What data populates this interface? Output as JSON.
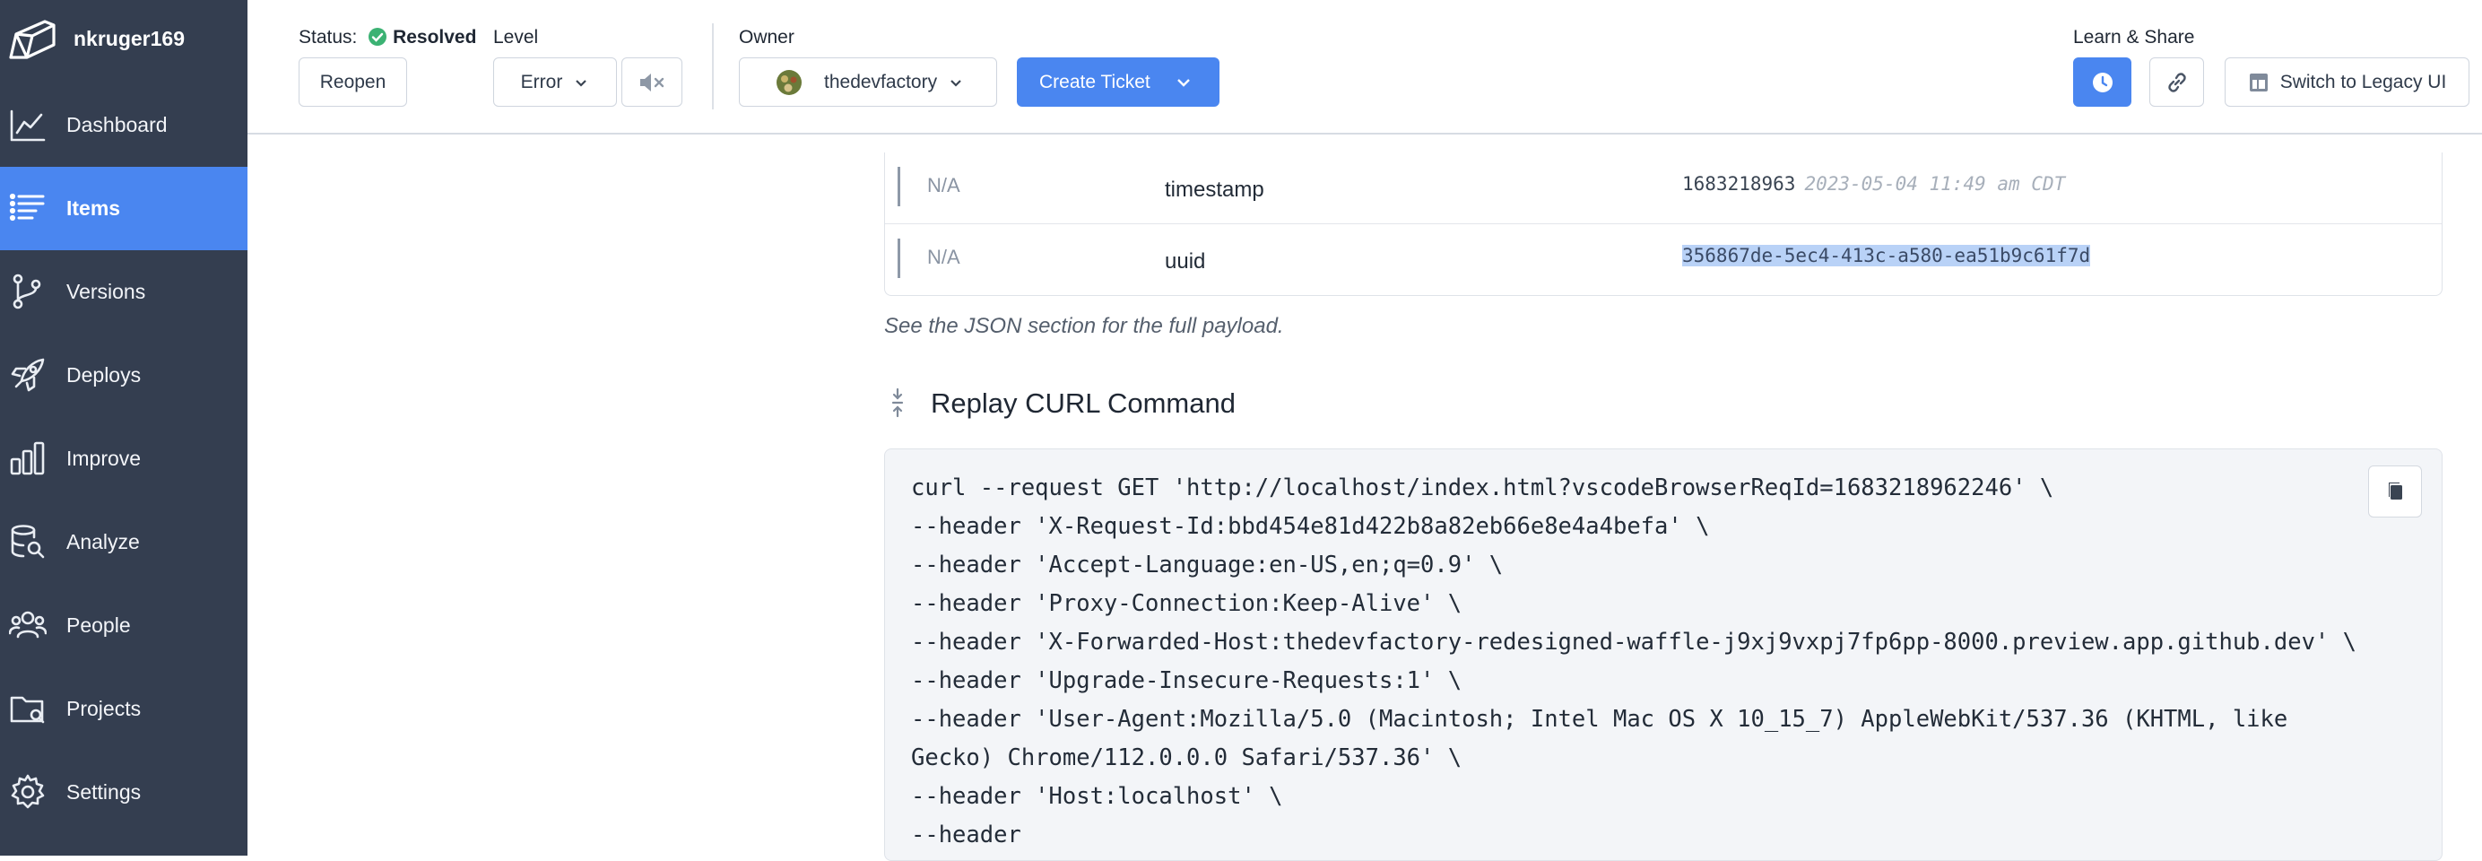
{
  "sidebar": {
    "username": "nkruger169",
    "items": [
      {
        "label": "Dashboard",
        "icon": "chart-line-icon"
      },
      {
        "label": "Items",
        "icon": "list-icon",
        "active": true
      },
      {
        "label": "Versions",
        "icon": "git-branch-icon"
      },
      {
        "label": "Deploys",
        "icon": "rocket-icon"
      },
      {
        "label": "Improve",
        "icon": "bar-chart-icon"
      },
      {
        "label": "Analyze",
        "icon": "database-search-icon"
      },
      {
        "label": "People",
        "icon": "people-icon"
      },
      {
        "label": "Projects",
        "icon": "folder-icon"
      },
      {
        "label": "Settings",
        "icon": "gear-icon"
      }
    ],
    "active_color": "#4a86f0",
    "bg_color": "#343e50"
  },
  "header": {
    "status_label": "Status:",
    "status_value": "Resolved",
    "reopen_label": "Reopen",
    "level_label": "Level",
    "level_value": "Error",
    "owner_label": "Owner",
    "owner_value": "thedevfactory",
    "create_ticket_label": "Create Ticket",
    "learn_share_label": "Learn & Share",
    "legacy_label": "Switch to Legacy UI"
  },
  "params": {
    "rows": [
      {
        "na": "N/A",
        "key": "timestamp",
        "value": "1683218963",
        "datetime": "2023-05-04 11:49 am CDT"
      },
      {
        "na": "N/A",
        "key": "uuid",
        "value": "356867de-5ec4-413c-a580-ea51b9c61f7d"
      }
    ],
    "note": "See the JSON section for the full payload."
  },
  "replay": {
    "title": "Replay CURL Command",
    "code": "curl --request GET 'http://localhost/index.html?vscodeBrowserReqId=1683218962246' \\\n--header 'X-Request-Id:bbd454e81d422b8a82eb66e8e4a4befa' \\\n--header 'Accept-Language:en-US,en;q=0.9' \\\n--header 'Proxy-Connection:Keep-Alive' \\\n--header 'X-Forwarded-Host:thedevfactory-redesigned-waffle-j9xj9vxpj7fp6pp-8000.preview.app.github.dev' \\\n--header 'Upgrade-Insecure-Requests:1' \\\n--header 'User-Agent:Mozilla/5.0 (Macintosh; Intel Mac OS X 10_15_7) AppleWebKit/537.36 (KHTML, like\nGecko) Chrome/112.0.0.0 Safari/537.36' \\\n--header 'Host:localhost' \\\n--header"
  }
}
